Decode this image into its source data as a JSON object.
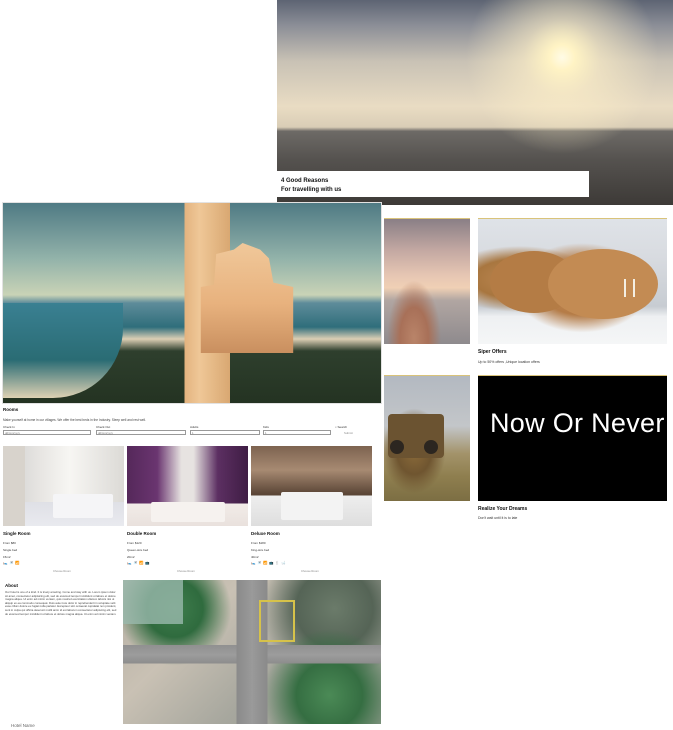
{
  "hero": {
    "reasons_line1": "4 Good Reasons",
    "reasons_line2": "For travelling with us"
  },
  "offers": {
    "siper_title": "Siper Offers",
    "siper_sub": "Up to 50% offers ,Unique location offers",
    "now_text": "Now Or Never",
    "realize_title": "Realize Your Dreams",
    "realize_sub": "Don't wait until it is to late"
  },
  "rooms_section": {
    "title": "Rooms",
    "intro": "Make yourself at home in our villages. We offer the best beds in the Industry. Sleep well and rest well.",
    "check_in_label": "Check In",
    "check_in_value": "dd/mm/yyyy",
    "check_out_label": "Check Out",
    "check_out_value": "dd/mm/yyyy",
    "adults_label": "Adults",
    "adults_value": "1",
    "kids_label": "Kids",
    "kids_value": "1",
    "search_label": "Search",
    "search_button": "Submit"
  },
  "rooms": [
    {
      "title": "Single Room",
      "price": "From $80",
      "bed": "Single bed",
      "size": "15m2",
      "icons": "🛌 🚿 📶",
      "choose": "Choose Room"
    },
    {
      "title": "Double Room",
      "price": "From $120",
      "bed": "Queen-size bed",
      "size": "20m2",
      "icons": "🛌 🚿 📶 📺",
      "choose": "Choose Room"
    },
    {
      "title": "Deluxe Room",
      "price": "From $180",
      "bed": "King-size bed",
      "size": "40m2",
      "icons": "🛌 🚿 📶 📺 🍴 🛁",
      "choose": "Choose Room"
    }
  ],
  "about": {
    "title": "About",
    "text": "Our hotel is one of a kind. It is truely amazing. Come and stay with us. Lorem ipsum dolor sit amet, consectetur adipisicing elit, sed do eiusmod tempor incididunt ut labore et dolore magna aliqua. Ut enim ad minim veniam, quis nostrud exercitation ullamco laboris nisi ut aliquip ex ea commodo consequat. Duis aute irure dolor in reprehenderit in voluptate velit esse cillum dolore eu fugiat nulla pariatur. Excepteur sint occaecat cupidatat non proident, sunt in culpa qui officia deserunt mollit anim id est laborum consectetur adipiscing elit, sed do eiusmod tempor incididunt ut labore et dolore magna aliqua. Ut enim ad minim veniam."
  },
  "footer": {
    "name": "Hotel Name"
  }
}
